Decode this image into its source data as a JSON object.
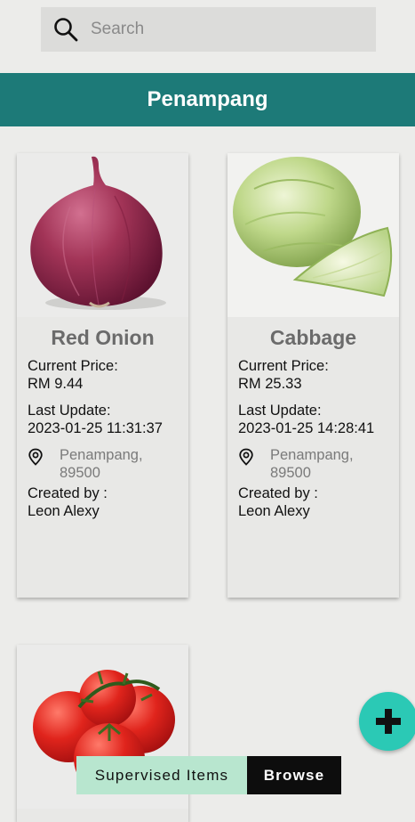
{
  "search": {
    "placeholder": "Search",
    "icon": "search-icon"
  },
  "header": {
    "title": "Penampang",
    "color": "#1d7a78"
  },
  "items": [
    {
      "name": "Red Onion",
      "image_icon": "red-onion-image",
      "price_label": "Current Price:",
      "price": "RM 9.44",
      "update_label": "Last Update:",
      "update": "2023-01-25 11:31:37",
      "location_line1": "Penampang,",
      "location_line2": "89500",
      "created_label": "Created by :",
      "created_by": "Leon Alexy"
    },
    {
      "name": "Cabbage",
      "image_icon": "cabbage-image",
      "price_label": "Current Price:",
      "price": "RM 25.33",
      "update_label": "Last Update:",
      "update": "2023-01-25 14:28:41",
      "location_line1": "Penampang,",
      "location_line2": "89500",
      "created_label": "Created by :",
      "created_by": "Leon Alexy"
    },
    {
      "image_icon": "tomato-image"
    }
  ],
  "fab": {
    "icon": "plus-icon",
    "color": "#2bc9b5"
  },
  "tabs": {
    "supervised": "Supervised Items",
    "browse": "Browse"
  }
}
